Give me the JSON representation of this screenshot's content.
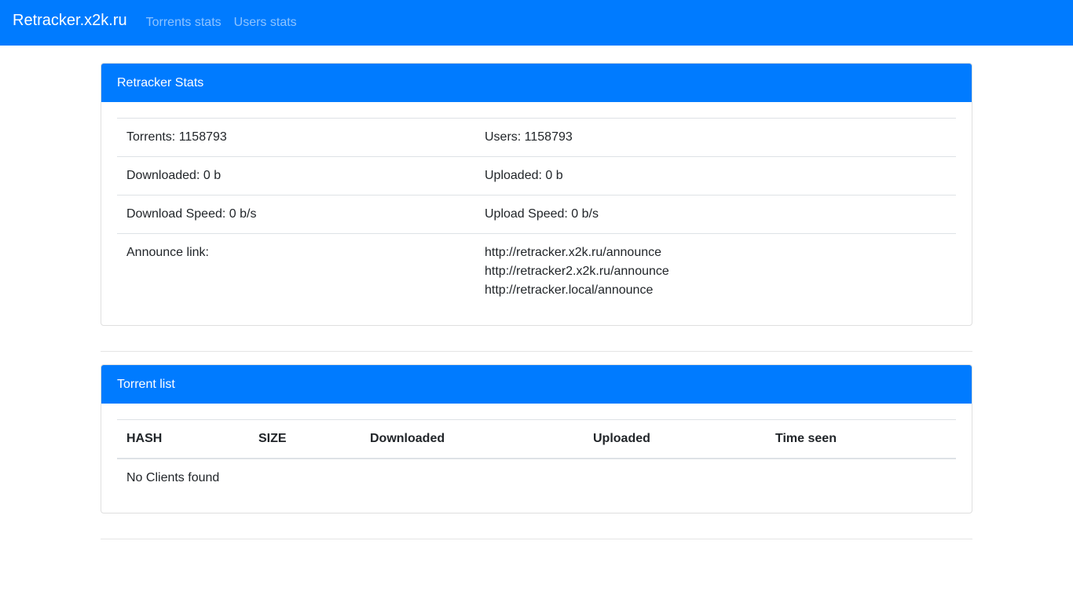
{
  "navbar": {
    "brand": "Retracker.x2k.ru",
    "links": [
      "Torrents stats",
      "Users stats"
    ]
  },
  "stats_card": {
    "title": "Retracker Stats",
    "rows": [
      {
        "left": "Torrents: 1158793",
        "right": "Users: 1158793"
      },
      {
        "left": "Downloaded: 0 b",
        "right": "Uploaded: 0 b"
      },
      {
        "left": "Download Speed: 0 b/s",
        "right": "Upload Speed: 0 b/s"
      }
    ],
    "announce_label": "Announce link:",
    "announce_links": [
      "http://retracker.x2k.ru/announce",
      "http://retracker2.x2k.ru/announce",
      "http://retracker.local/announce"
    ]
  },
  "torrent_card": {
    "title": "Torrent list",
    "columns": [
      "HASH",
      "SIZE",
      "Downloaded",
      "Uploaded",
      "Time seen"
    ],
    "empty_message": "No Clients found"
  },
  "colors": {
    "primary": "#007bff"
  }
}
